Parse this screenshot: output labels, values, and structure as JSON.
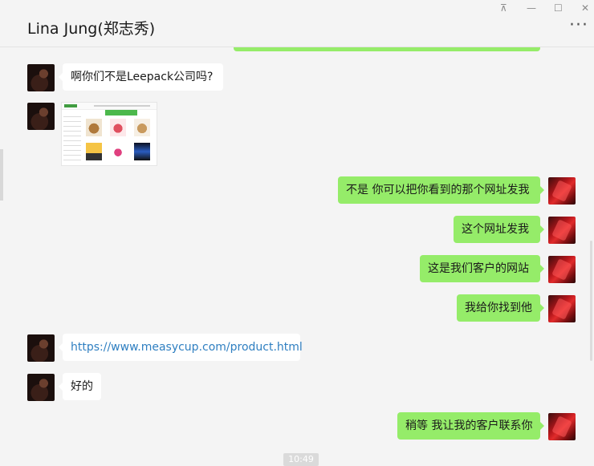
{
  "chat": {
    "title": "Lina Jung(郑志秀)",
    "window_controls": {
      "pin": "⊼",
      "minimize": "—",
      "maximize": "☐",
      "close": "✕"
    },
    "more_icon": "···"
  },
  "messages": [
    {
      "sender": "them",
      "type": "text",
      "text": "啊你们不是Leepack公司吗?"
    },
    {
      "sender": "them",
      "type": "image",
      "text": ""
    },
    {
      "sender": "me",
      "type": "text",
      "text": "不是 你可以把你看到的那个网址发我"
    },
    {
      "sender": "me",
      "type": "text",
      "text": "这个网址发我"
    },
    {
      "sender": "me",
      "type": "text",
      "text": "这是我们客户的网站"
    },
    {
      "sender": "me",
      "type": "text",
      "text": "我给你找到他"
    },
    {
      "sender": "them",
      "type": "link",
      "text": "https://www.measycup.com/product.html"
    },
    {
      "sender": "them",
      "type": "text",
      "text": "好的"
    },
    {
      "sender": "me",
      "type": "text",
      "text": "稍等 我让我的客户联系你"
    }
  ],
  "timestamp": "10:49",
  "colors": {
    "outgoing_bubble": "#95ec69",
    "incoming_bubble": "#ffffff",
    "link": "#2f7fc1",
    "background": "#f4f4f4"
  }
}
